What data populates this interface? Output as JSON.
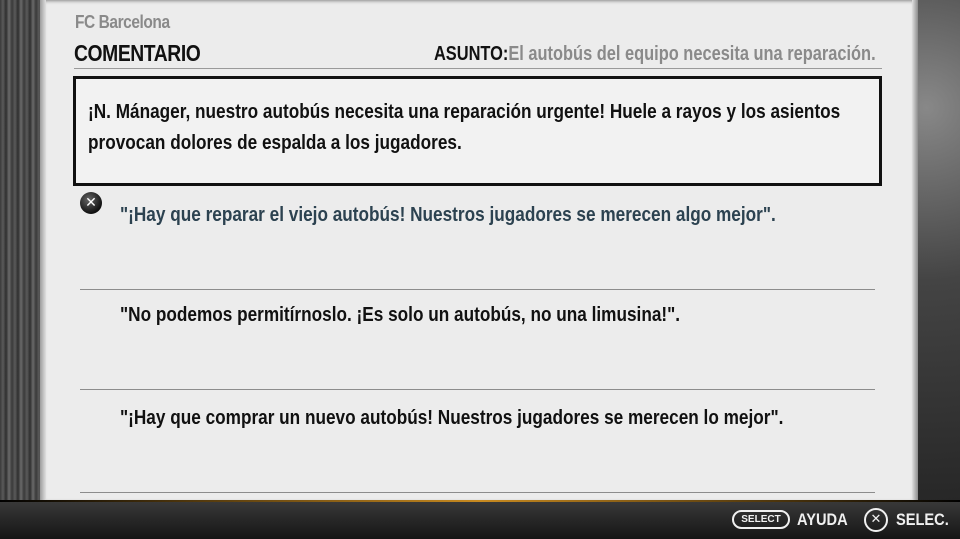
{
  "header": {
    "club": "FC Barcelona",
    "title": "COMENTARIO",
    "subject_label": "ASUNTO:",
    "subject_value": "El autobús del equipo necesita una reparación."
  },
  "message": {
    "line1": "¡N. Mánager, nuestro autobús necesita una reparación urgente! Huele a rayos y los asientos",
    "line2": "provocan dolores de espalda a los jugadores."
  },
  "options": [
    {
      "text": "\"¡Hay que reparar el viejo autobús! Nuestros jugadores se merecen algo mejor\".",
      "selected": true
    },
    {
      "text": "\"No podemos permitírnoslo. ¡Es solo un autobús, no una limusina!\".",
      "selected": false
    },
    {
      "text": "\"¡Hay que comprar un nuevo autobús! Nuestros jugadores se merecen lo mejor\".",
      "selected": false
    }
  ],
  "footer": {
    "select_icon_label": "SELECT",
    "help_label": "AYUDA",
    "cross_icon_glyph": "✕",
    "select_label": "SELEC."
  },
  "icons": {
    "cursor": "cross-button-icon",
    "select": "select-button-icon",
    "confirm": "cross-button-icon"
  }
}
